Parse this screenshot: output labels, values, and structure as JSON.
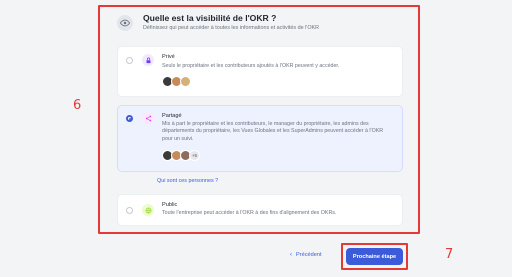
{
  "header": {
    "title": "Quelle est la visibilité de l'OKR ?",
    "subtitle": "Définissez qui peut accéder à toutes les informations et activités de l'OKR",
    "icon": "eye-icon"
  },
  "options": [
    {
      "key": "prive",
      "title": "Privé",
      "description": "Seuls le propriétaire et les contributeurs ajoutés à l'OKR peuvent y accéder.",
      "icon": "lock-icon",
      "icon_color": "#7c3aed",
      "selected": false,
      "avatars_more": ""
    },
    {
      "key": "partage",
      "title": "Partagé",
      "description": "Mis à part le propriétaire et les contributeurs, le manager du propriétaire, les admins des départements du propriétaire, les Vues Globales et les SuperAdmins peuvent accéder à l'OKR pour un suivi.",
      "icon": "share-icon",
      "icon_color": "#d946ef",
      "selected": true,
      "avatars_more": "+5"
    },
    {
      "key": "public",
      "title": "Public",
      "description": "Toute l'entreprise peut accéder à l'OKR à des fins d'alignement des OKRs.",
      "icon": "globe-icon",
      "icon_color": "#84cc16",
      "selected": false,
      "avatars_more": ""
    }
  ],
  "link_who": "Qui sont ces personnes ?",
  "footer": {
    "prev_label": "Précédent",
    "next_label": "Prochaine étape"
  },
  "annotations": {
    "box_label": "6",
    "button_label": "7",
    "color": "#e53935"
  },
  "colors": {
    "accent": "#3b5bdb",
    "selected_bg": "#eef2ff"
  }
}
